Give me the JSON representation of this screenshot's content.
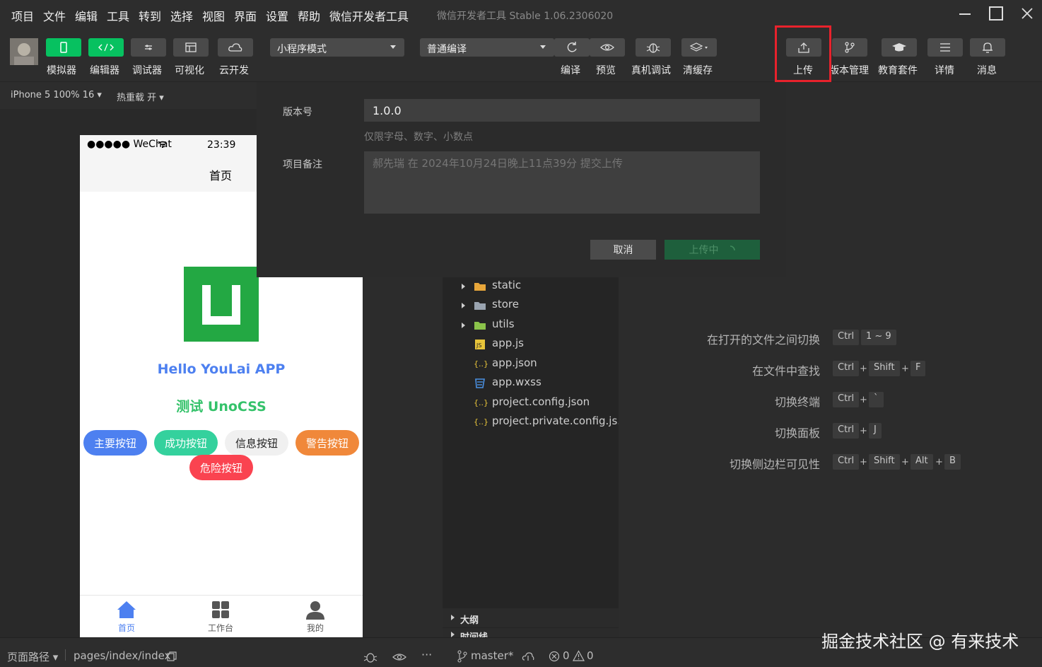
{
  "menubar": {
    "items": [
      "项目",
      "文件",
      "编辑",
      "工具",
      "转到",
      "选择",
      "视图",
      "界面",
      "设置",
      "帮助",
      "微信开发者工具"
    ],
    "app_title": "微信开发者工具 Stable 1.06.2306020"
  },
  "toolbar": {
    "left_buttons": [
      "模拟器",
      "编辑器",
      "调试器",
      "可视化",
      "云开发"
    ],
    "mode_select": "小程序模式",
    "compile_select": "普通编译",
    "mid_buttons": [
      "编译",
      "预览",
      "真机调试",
      "清缓存"
    ],
    "right_buttons": [
      "上传",
      "版本管理",
      "教育套件",
      "详情",
      "消息"
    ],
    "accent_color": "#07c160",
    "highlight_color": "#e8222c"
  },
  "simulator": {
    "device": "iPhone 5 100% 16",
    "hot_reload": "热重载 开",
    "status_carrier": "●●●●● WeChat",
    "status_time": "23:39",
    "nav_title": "首页",
    "hello_text": "Hello YouLai APP",
    "uno_text": "测试 UnoCSS",
    "buttons": [
      {
        "label": "主要按钮",
        "color": "#4d80f0"
      },
      {
        "label": "成功按钮",
        "color": "#34d19d"
      },
      {
        "label": "信息按钮",
        "color": "#f0f0f0"
      },
      {
        "label": "警告按钮",
        "color": "#f0883a"
      },
      {
        "label": "危险按钮",
        "color": "#fa4350"
      }
    ],
    "tabs": [
      "首页",
      "工作台",
      "我的"
    ]
  },
  "dialog": {
    "version_label": "版本号",
    "version_value": "1.0.0",
    "version_hint": "仅限字母、数字、小数点",
    "note_label": "项目备注",
    "note_placeholder": "郝先瑞 在 2024年10月24日晚上11点39分 提交上传",
    "cancel_label": "取消",
    "upload_label": "上传中"
  },
  "file_tree": {
    "items": [
      {
        "name": "static",
        "type": "folder",
        "expandable": true
      },
      {
        "name": "store",
        "type": "folder",
        "expandable": true
      },
      {
        "name": "utils",
        "type": "folder",
        "expandable": true
      },
      {
        "name": "app.js",
        "type": "js",
        "expandable": false
      },
      {
        "name": "app.json",
        "type": "json",
        "expandable": false
      },
      {
        "name": "app.wxss",
        "type": "css",
        "expandable": false
      },
      {
        "name": "project.config.json",
        "type": "json",
        "expandable": false
      },
      {
        "name": "project.private.config.js...",
        "type": "json",
        "expandable": false
      }
    ],
    "sections": [
      "大纲",
      "时间线"
    ]
  },
  "shortcuts": [
    {
      "label": "在打开的文件之间切换",
      "keys": [
        "Ctrl",
        "1 ~ 9"
      ]
    },
    {
      "label": "在文件中查找",
      "keys": [
        "Ctrl",
        "Shift",
        "F"
      ]
    },
    {
      "label": "切换终端",
      "keys": [
        "Ctrl",
        "`"
      ]
    },
    {
      "label": "切换面板",
      "keys": [
        "Ctrl",
        "J"
      ]
    },
    {
      "label": "切换侧边栏可见性",
      "keys": [
        "Ctrl",
        "Shift",
        "Alt",
        "B"
      ]
    }
  ],
  "statusbar": {
    "page_path_label": "页面路径",
    "page_path": "pages/index/index",
    "branch": "master*",
    "errors": "0",
    "warnings": "0"
  },
  "watermark": "掘金技术社区 @ 有来技术"
}
